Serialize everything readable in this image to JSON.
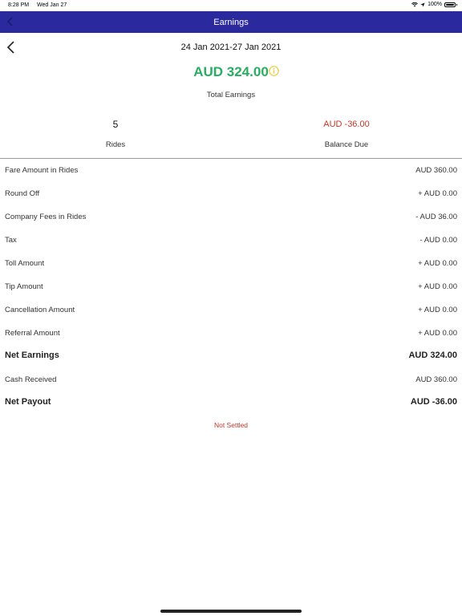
{
  "status_bar": {
    "time": "8:28 PM",
    "date": "Wed Jan 27",
    "battery": "100%"
  },
  "nav": {
    "title": "Earnings"
  },
  "header": {
    "date_range": "24 Jan 2021-27 Jan 2021",
    "total_amount": "AUD 324.00",
    "total_label": "Total Earnings"
  },
  "summary": {
    "rides_value": "5",
    "rides_label": "Rides",
    "balance_value": "AUD -36.00",
    "balance_label": "Balance Due"
  },
  "breakdown": [
    {
      "label": "Fare Amount in Rides",
      "value": "AUD 360.00"
    },
    {
      "label": "Round Off",
      "value": "+ AUD 0.00"
    },
    {
      "label": "Company Fees in Rides",
      "value": "- AUD 36.00"
    },
    {
      "label": "Tax",
      "value": "- AUD 0.00"
    },
    {
      "label": "Toll Amount",
      "value": "+ AUD 0.00"
    },
    {
      "label": "Tip Amount",
      "value": "+ AUD 0.00"
    },
    {
      "label": "Cancellation Amount",
      "value": "+ AUD 0.00"
    },
    {
      "label": "Referral Amount",
      "value": "+ AUD 0.00"
    },
    {
      "label": "Net Earnings",
      "value": "AUD 324.00"
    },
    {
      "label": "Cash Received",
      "value": "AUD 360.00"
    },
    {
      "label": "Net Payout",
      "value": "AUD -36.00"
    }
  ],
  "settle_status": "Not Settled",
  "colors": {
    "nav_bg": "#2a2a9e",
    "positive": "#27ae60",
    "negative": "#c0392b",
    "info": "#e6c619"
  },
  "icons": {
    "nav_back": "chevron-left-icon",
    "date_back": "chevron-left-icon",
    "info": "info-circle-icon"
  }
}
